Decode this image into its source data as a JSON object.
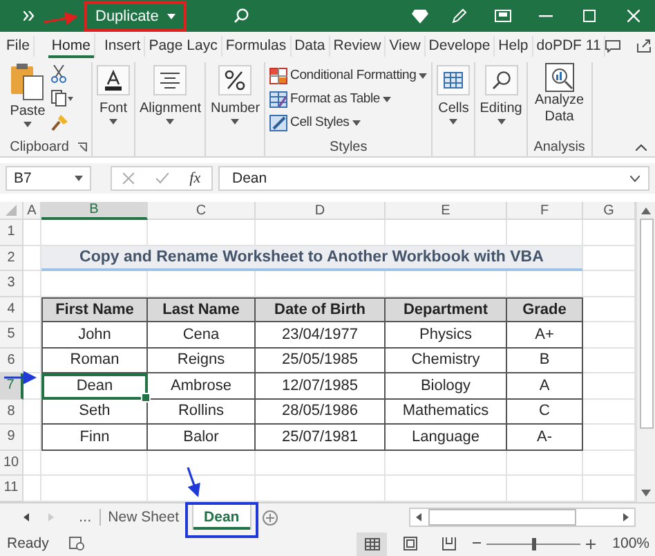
{
  "title_bar": {
    "document_title": "Duplicate"
  },
  "ribbon": {
    "tabs": [
      {
        "label": "File",
        "selected": false
      },
      {
        "label": "Home",
        "selected": true
      },
      {
        "label": "Insert",
        "selected": false
      },
      {
        "label": "Page Layc",
        "selected": false
      },
      {
        "label": "Formulas",
        "selected": false
      },
      {
        "label": "Data",
        "selected": false
      },
      {
        "label": "Review",
        "selected": false
      },
      {
        "label": "View",
        "selected": false
      },
      {
        "label": "Develope",
        "selected": false
      },
      {
        "label": "Help",
        "selected": false
      },
      {
        "label": "doPDF 11",
        "selected": false
      }
    ],
    "groups": [
      {
        "kind": "clipboard",
        "label": "Clipboard",
        "button": "Paste"
      },
      {
        "kind": "dropdown",
        "button": "Font"
      },
      {
        "kind": "dropdown",
        "button": "Alignment"
      },
      {
        "kind": "dropdown",
        "button": "Number"
      },
      {
        "kind": "list",
        "label": "Styles",
        "items": [
          "Conditional Formatting",
          "Format as Table",
          "Cell Styles"
        ]
      },
      {
        "kind": "dropdown",
        "button": "Cells"
      },
      {
        "kind": "dropdown",
        "button": "Editing"
      },
      {
        "kind": "large",
        "label": "Analysis",
        "button": "Analyze Data"
      }
    ]
  },
  "formula_bar": {
    "name_box": "B7",
    "function_button": "fx",
    "value": "Dean"
  },
  "sheet": {
    "column_letters": [
      "A",
      "B",
      "C",
      "D",
      "E",
      "F",
      "G"
    ],
    "row_numbers": [
      "1",
      "2",
      "3",
      "4",
      "5",
      "6",
      "7",
      "8",
      "9",
      "10",
      "11"
    ],
    "title": "Copy and Rename Worksheet to Another Workbook with VBA",
    "table": {
      "headers": [
        "First Name",
        "Last Name",
        "Date of Birth",
        "Department",
        "Grade"
      ],
      "rows": [
        {
          "cells": [
            {
              "text": "John",
              "selected": false
            },
            {
              "text": "Cena",
              "selected": false
            },
            {
              "text": "23/04/1977",
              "selected": false
            },
            {
              "text": "Physics",
              "selected": false
            },
            {
              "text": "A+",
              "selected": false
            }
          ]
        },
        {
          "cells": [
            {
              "text": "Roman",
              "selected": false
            },
            {
              "text": "Reigns",
              "selected": false
            },
            {
              "text": "25/05/1985",
              "selected": false
            },
            {
              "text": "Chemistry",
              "selected": false
            },
            {
              "text": "B",
              "selected": false
            }
          ]
        },
        {
          "cells": [
            {
              "text": "Dean",
              "selected": true
            },
            {
              "text": "Ambrose",
              "selected": false
            },
            {
              "text": "12/07/1985",
              "selected": false
            },
            {
              "text": "Biology",
              "selected": false
            },
            {
              "text": "A",
              "selected": false
            }
          ]
        },
        {
          "cells": [
            {
              "text": "Seth",
              "selected": false
            },
            {
              "text": "Rollins",
              "selected": false
            },
            {
              "text": "28/05/1986",
              "selected": false
            },
            {
              "text": "Mathematics",
              "selected": false
            },
            {
              "text": "C",
              "selected": false
            }
          ]
        },
        {
          "cells": [
            {
              "text": "Finn",
              "selected": false
            },
            {
              "text": "Balor",
              "selected": false
            },
            {
              "text": "25/07/1981",
              "selected": false
            },
            {
              "text": "Language",
              "selected": false
            },
            {
              "text": "A-",
              "selected": false
            }
          ]
        }
      ]
    }
  },
  "sheet_tabs": {
    "overflow": "...",
    "tabs": [
      {
        "label": "New Sheet",
        "selected": false
      },
      {
        "label": "Dean",
        "selected": true
      }
    ]
  },
  "status_bar": {
    "status": "Ready",
    "zoom": {
      "level": 0.5,
      "reading": "100%"
    }
  }
}
